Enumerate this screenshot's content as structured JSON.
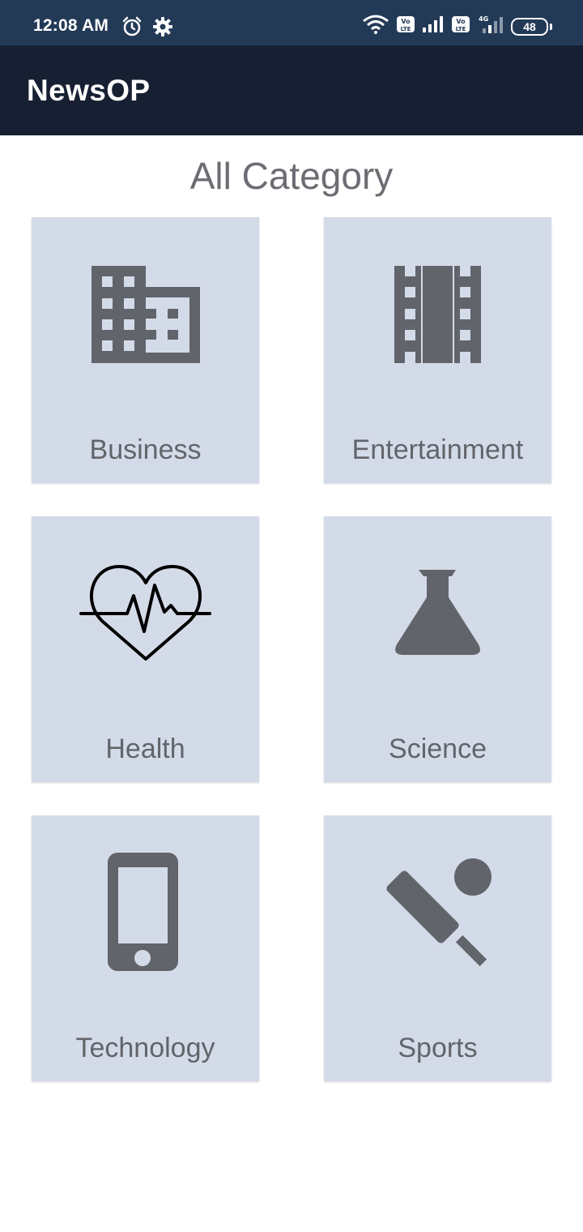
{
  "status_bar": {
    "time": "12:08 AM",
    "battery": "48",
    "battery_level": 0.48,
    "icons": [
      "alarm-icon",
      "settings-gear-icon",
      "wifi-icon",
      "volte-icon",
      "signal-icon",
      "volte-icon",
      "signal-4g-icon",
      "battery-icon"
    ]
  },
  "app_bar": {
    "title": "NewsOP"
  },
  "page": {
    "heading": "All Category"
  },
  "categories": [
    {
      "label": "Business",
      "icon": "office-building-icon"
    },
    {
      "label": "Entertainment",
      "icon": "film-strip-icon"
    },
    {
      "label": "Health",
      "icon": "heart-pulse-icon"
    },
    {
      "label": "Science",
      "icon": "flask-icon"
    },
    {
      "label": "Technology",
      "icon": "smartphone-icon"
    },
    {
      "label": "Sports",
      "icon": "cricket-bat-ball-icon"
    }
  ],
  "colors": {
    "status_bar": "#233a57",
    "app_bar": "#172033",
    "card_background": "#d4dbe8",
    "icon": "#62646b",
    "heading": "#6b6d72"
  }
}
